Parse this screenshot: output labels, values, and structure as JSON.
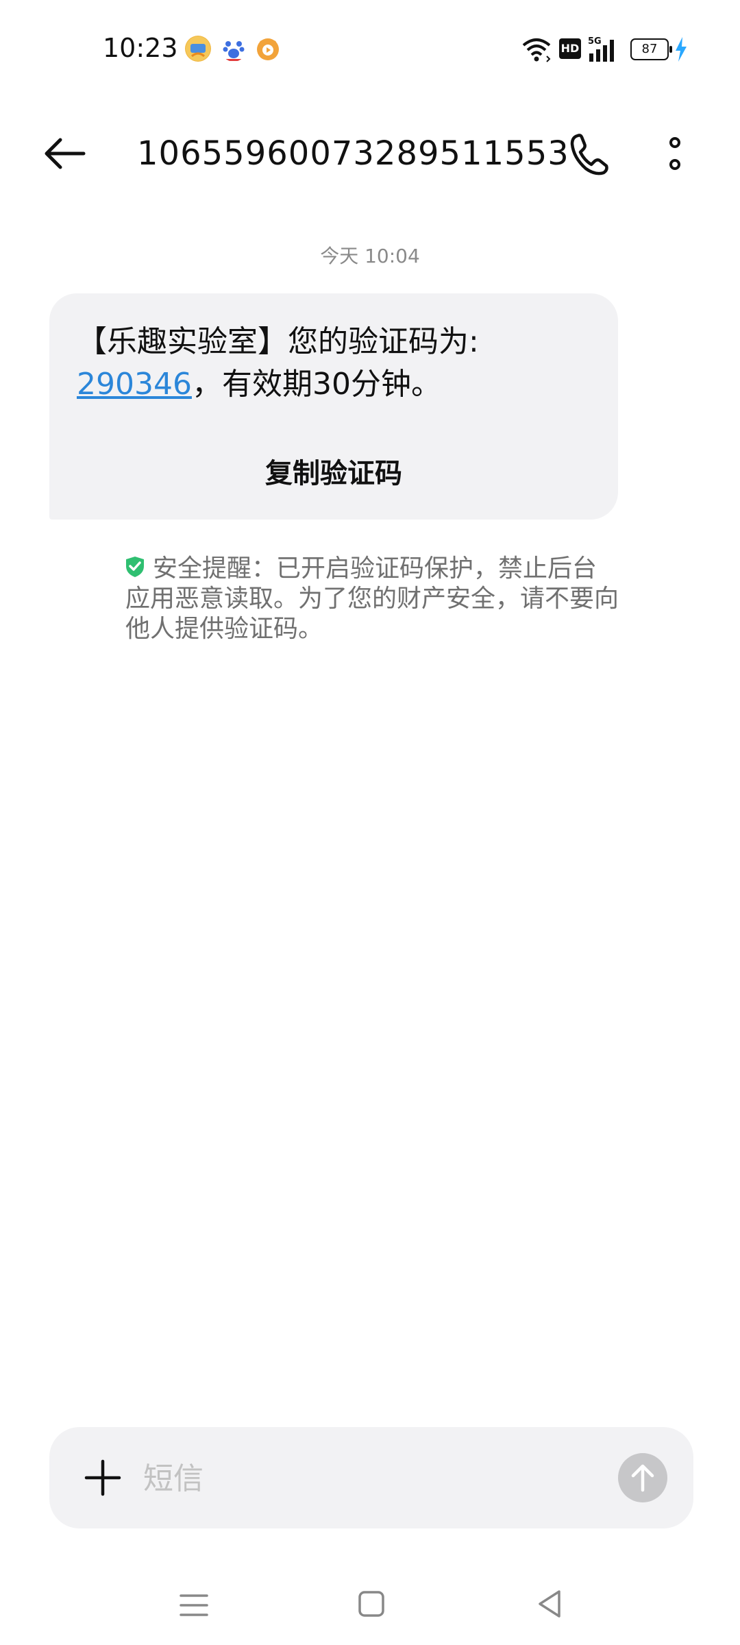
{
  "status_bar": {
    "time": "10:23",
    "app_icons": [
      "novel-reader-icon",
      "baidu-icon",
      "video-app-icon"
    ],
    "hd_label": "HD",
    "network_label": "5G",
    "battery": "87",
    "charging": true
  },
  "header": {
    "title": "10655960073289511553"
  },
  "conversation": {
    "date_label": "今天 10:04",
    "message": {
      "prefix": "【乐趣实验室】您的验证码为:",
      "code": "290346",
      "suffix": "，有效期30分钟。",
      "copy_label": "复制验证码"
    },
    "security_note": "安全提醒：已开启验证码保护，禁止后台应用恶意读取。为了您的财产安全，请不要向他人提供验证码。"
  },
  "composer": {
    "placeholder": "短信"
  },
  "colors": {
    "link": "#2b86d9",
    "bubble": "#f2f2f4",
    "shield": "#2fbf71",
    "charge": "#2aa8ff"
  }
}
